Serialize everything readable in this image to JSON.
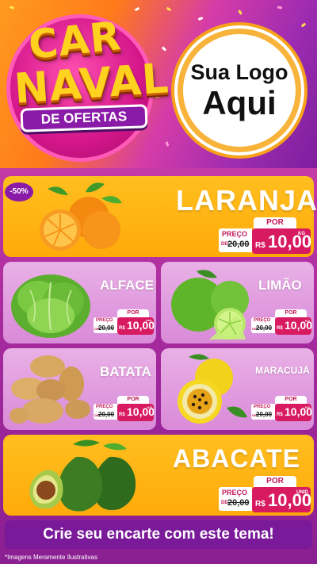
{
  "header": {
    "badge_line1": "CAR",
    "badge_line2": "NAVAL",
    "badge_ribbon": "DE OFERTAS",
    "logo_line1": "Sua Logo",
    "logo_line2": "Aqui"
  },
  "discount_badge": "-50%",
  "products": {
    "laranja": {
      "name": "LARANJA",
      "por": "POR",
      "preco_label": "PREÇO",
      "de": "DE",
      "old": "20,00",
      "currency": "R$",
      "price": "10,00",
      "unit": "KG"
    },
    "alface": {
      "name": "ALFACE",
      "por": "POR",
      "preco_label": "PREÇO",
      "de": "DE",
      "old": "20,00",
      "currency": "R$",
      "price": "10,00",
      "unit": "UNID"
    },
    "limao": {
      "name": "LIMÃO",
      "por": "POR",
      "preco_label": "PREÇO",
      "de": "DE",
      "old": "20,00",
      "currency": "R$",
      "price": "10,00",
      "unit": "KG"
    },
    "batata": {
      "name": "BATATA",
      "por": "POR",
      "preco_label": "PREÇO",
      "de": "DE",
      "old": "20,00",
      "currency": "R$",
      "price": "10,00",
      "unit": "KG"
    },
    "maracuja": {
      "name": "MARACUJÁ",
      "por": "POR",
      "preco_label": "PREÇO",
      "de": "DE",
      "old": "20,00",
      "currency": "R$",
      "price": "10,00",
      "unit": "KG"
    },
    "abacate": {
      "name": "ABACATE",
      "por": "POR",
      "preco_label": "PREÇO",
      "de": "DE",
      "old": "20,00",
      "currency": "R$",
      "price": "10,00",
      "unit": "UNID"
    }
  },
  "cta": "Crie seu encarte com este tema!",
  "footnote": "*Imagens Meramente Ilustrativas",
  "colors": {
    "orange_panel": "#ffb414",
    "pink_panel": "#e2a0e0",
    "magenta_price": "#d81b60",
    "purple_bar": "#7a1a9a"
  }
}
